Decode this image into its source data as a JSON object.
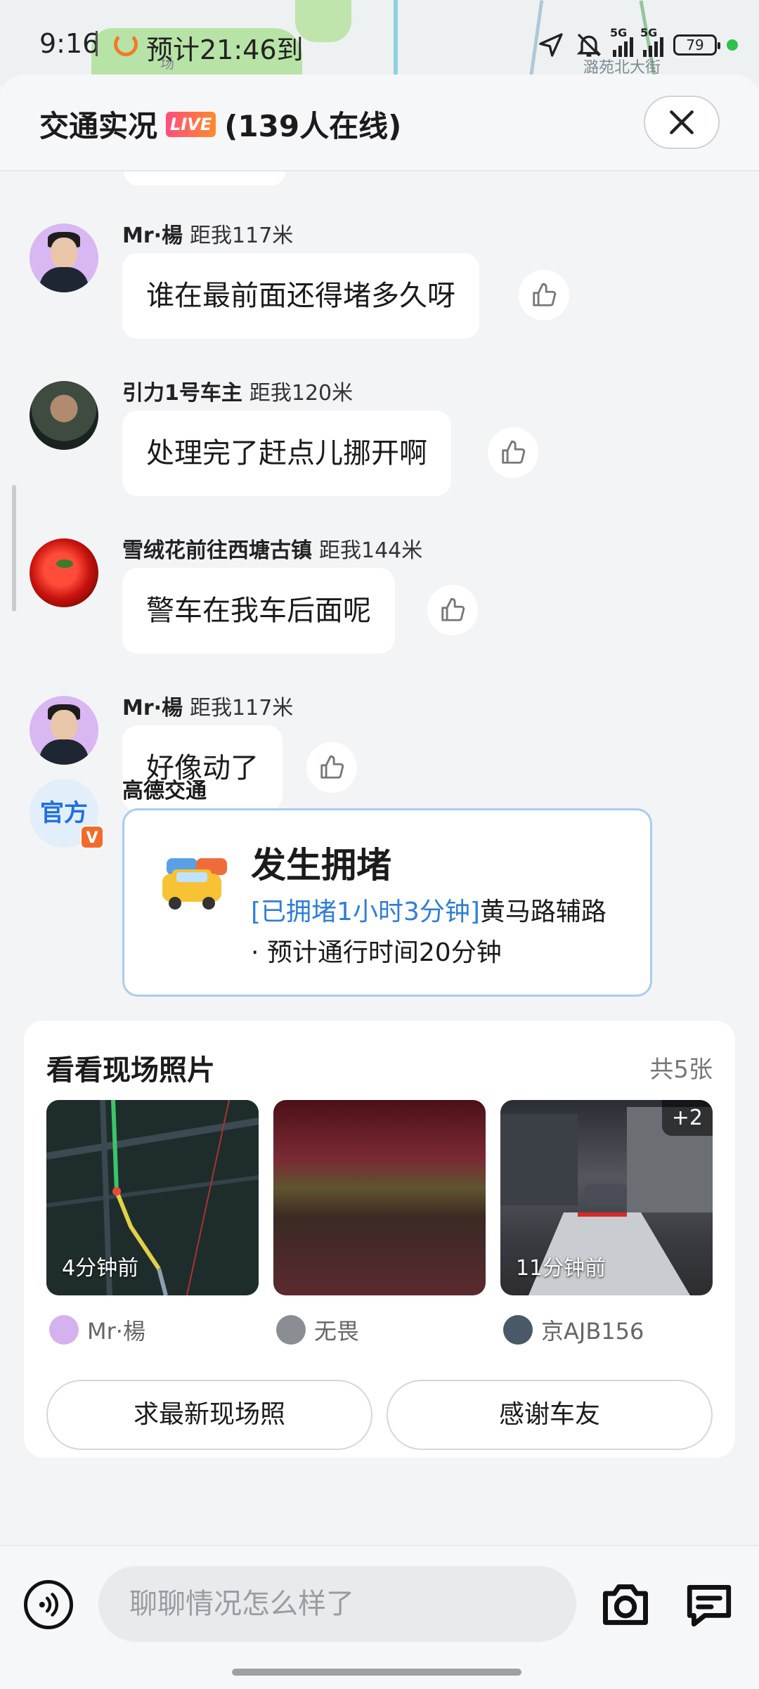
{
  "status_bar": {
    "time": "9:16",
    "eta": "预计21:46到",
    "battery": "79",
    "network": "5G",
    "map_label": "潞苑北大街",
    "map_label2": "场"
  },
  "header": {
    "title": "交通实况",
    "live_badge": "LIVE",
    "online": "(139人在线)"
  },
  "messages": [
    {
      "user": "Mr·楊",
      "distance": "距我117米",
      "text": "谁在最前面还得堵多久呀"
    },
    {
      "user": "引力1号车主",
      "distance": "距我120米",
      "text": "处理完了赶点儿挪开啊"
    },
    {
      "user": "雪绒花前往西塘古镇",
      "distance": "距我144米",
      "text": "警车在我车后面呢"
    },
    {
      "user": "Mr·楊",
      "distance": "距我117米",
      "text": "好像动了"
    }
  ],
  "official": {
    "avatar_text": "官方",
    "verified": "V",
    "name": "高德交通",
    "card_title": "发生拥堵",
    "card_tag": "[已拥堵1小时3分钟]",
    "card_road": "黄马路辅路",
    "card_eta": "· 预计通行时间20分钟"
  },
  "photos": {
    "title": "看看现场照片",
    "count": "共5张",
    "items": [
      {
        "time": "4分钟前",
        "user": "Mr·楊"
      },
      {
        "time": "",
        "user": "无畏"
      },
      {
        "time": "11分钟前",
        "user": "京AJB156",
        "more": "+2"
      }
    ],
    "request_button": "求最新现场照",
    "thanks_button": "感谢车友"
  },
  "bottom": {
    "placeholder": "聊聊情况怎么样了"
  },
  "colors": {
    "accent_blue": "#2f7ed8",
    "live_gradient": "#ff4d7d",
    "official_orange": "#f36b2b",
    "status_green": "#2fc14b"
  }
}
